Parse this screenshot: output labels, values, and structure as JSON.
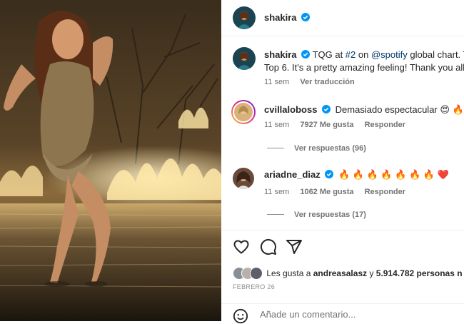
{
  "post": {
    "author": "shakira",
    "caption_text": "TQG at ",
    "caption_rank": "#2",
    "caption_on": " on ",
    "caption_mention": "@spotify",
    "caption_rest": " global chart. Tw",
    "caption_line2": "Top 6. It's a pretty amazing feeling! Thank you all",
    "caption_time": "11 sem",
    "see_translation": "Ver traducción"
  },
  "comments": [
    {
      "username": "cvillaloboss",
      "text": "Demasiado espectacular 😍 🔥 😝",
      "time": "11 sem",
      "likes": "7927 Me gusta",
      "reply": "Responder",
      "view_replies": "Ver respuestas (96)"
    },
    {
      "username": "ariadne_diaz",
      "text": "🔥 🔥 🔥 🔥 🔥 🔥 🔥 ❤️",
      "time": "11 sem",
      "likes": "1062 Me gusta",
      "reply": "Responder",
      "view_replies": "Ver respuestas (17)"
    }
  ],
  "likes_summary": {
    "prefix": "Les gusta a ",
    "user": "andreasalasz",
    "and": " y ",
    "count": "5.914.782 personas n"
  },
  "date": "FEBRERO 26",
  "composer": {
    "placeholder": "Añade un comentario..."
  },
  "icons": [
    "heart-icon",
    "comment-icon",
    "share-icon",
    "emoji-icon",
    "verified-icon"
  ],
  "colors": {
    "verified": "#0095f6",
    "link": "#00376b",
    "secondary": "#737373"
  }
}
